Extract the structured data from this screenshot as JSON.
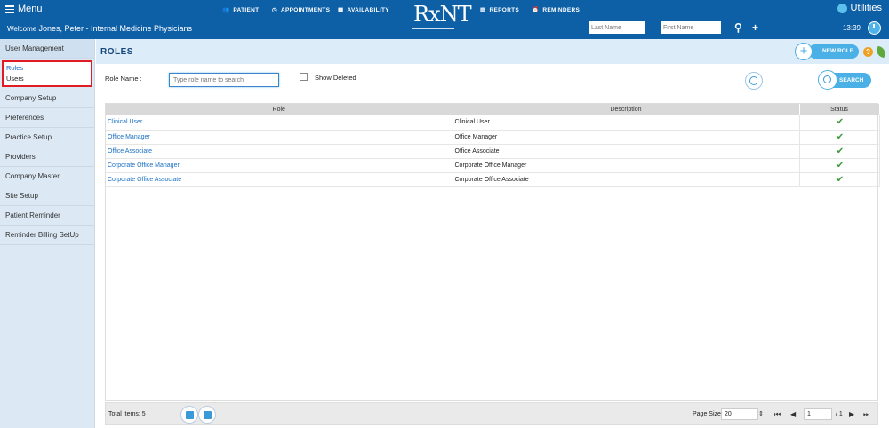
{
  "header": {
    "menu_label": "Menu",
    "welcome_prefix": "Welcome",
    "welcome_user": "Jones, Peter - Internal Medicine Physicians",
    "nav": {
      "patient": "PATIENT",
      "appointments": "APPOINTMENTS",
      "availability": "AVAILABILITY",
      "reports": "REPORTS",
      "reminders": "REMINDERS"
    },
    "logo": "RxNT",
    "utilities": "Utilities",
    "last_name_placeholder": "Last Name",
    "first_name_placeholder": "First Name",
    "time": "13:39"
  },
  "sidebar": {
    "items": [
      {
        "label": "User Management"
      },
      {
        "label": "Company Setup"
      },
      {
        "label": "Preferences"
      },
      {
        "label": "Practice Setup"
      },
      {
        "label": "Providers"
      },
      {
        "label": "Company Master"
      },
      {
        "label": "Site Setup"
      },
      {
        "label": "Patient Reminder"
      },
      {
        "label": "Reminder Billing SetUp"
      }
    ],
    "sub_items": [
      {
        "label": "Roles"
      },
      {
        "label": "Users"
      }
    ]
  },
  "main": {
    "title": "ROLES",
    "new_role": "NEW ROLE",
    "help": "?",
    "filter": {
      "role_name_label": "Role Name :",
      "role_name_placeholder": "Type role name to search",
      "show_deleted": "Show Deleted",
      "search": "SEARCH"
    },
    "table": {
      "headers": [
        "Role",
        "Description",
        "Status"
      ],
      "rows": [
        {
          "role": "Clinical User",
          "description": "Clinical User",
          "status": "✔"
        },
        {
          "role": "Office Manager",
          "description": "Office Manager",
          "status": "✔"
        },
        {
          "role": "Office Associate",
          "description": "Office Associate",
          "status": "✔"
        },
        {
          "role": "Corporate Office Manager",
          "description": "Corporate Office Manager",
          "status": "✔"
        },
        {
          "role": "Corporate Office Associate",
          "description": "Corporate Office Associate",
          "status": "✔"
        }
      ]
    },
    "pager": {
      "total_items": "Total Items: 5",
      "page_size_label": "Page Size:",
      "page_size": "20",
      "page": "1",
      "page_total": "/ 1"
    }
  },
  "colors": {
    "brand": "#0d5fa6",
    "accent": "#4ab0e6",
    "highlight": "#e01b24",
    "status_ok": "#3c9a3c"
  }
}
